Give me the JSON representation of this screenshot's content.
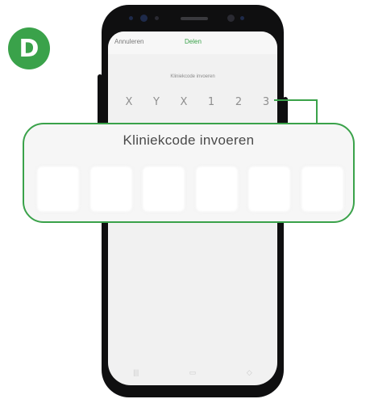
{
  "step_badge": "D",
  "phone": {
    "topbar": {
      "cancel_label": "Annuleren",
      "share_label": "Delen"
    },
    "screen_title": "Kliniekcode invoeren",
    "code_chars": [
      "X",
      "Y",
      "X",
      "1",
      "2",
      "3"
    ],
    "nav_icons": [
      "recent-apps-icon",
      "home-icon",
      "back-icon"
    ]
  },
  "callout": {
    "title": "Kliniekcode invoeren",
    "box_count": 6
  },
  "colors": {
    "accent": "#3aa24a",
    "phone_body": "#0f0f10",
    "screen_bg": "#f1f1f1"
  }
}
